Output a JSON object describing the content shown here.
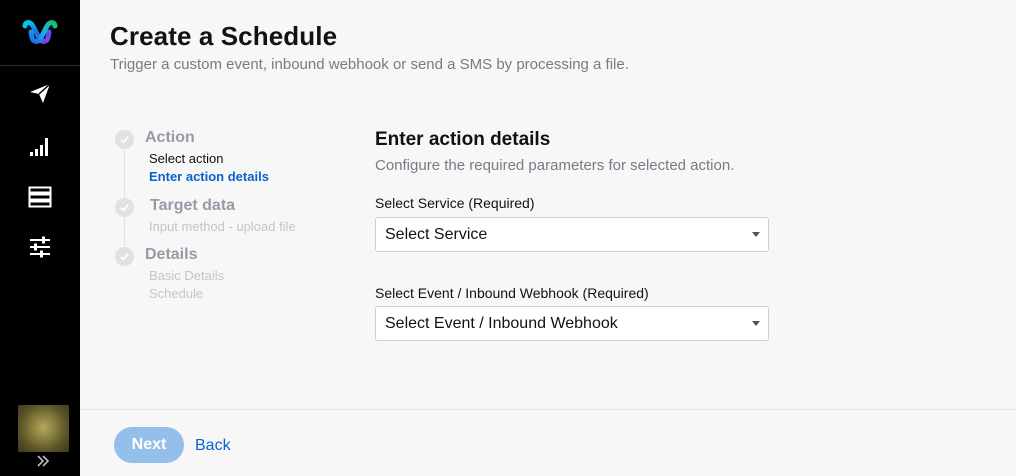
{
  "header": {
    "title": "Create a Schedule",
    "subtitle": "Trigger a custom event, inbound webhook or send a SMS by processing a file."
  },
  "sidebar": {
    "items": [
      {
        "icon": "send-icon"
      },
      {
        "icon": "bar-chart-icon"
      },
      {
        "icon": "table-icon"
      },
      {
        "icon": "sliders-icon"
      }
    ]
  },
  "stepper": {
    "steps": [
      {
        "title": "Action",
        "state": "in-progress",
        "substeps": [
          {
            "label": "Select action",
            "state": "done"
          },
          {
            "label": "Enter action details",
            "state": "active"
          }
        ]
      },
      {
        "title": "Target data",
        "state": "pending",
        "substeps": [
          {
            "label": "Input method - upload file",
            "state": "pending"
          }
        ]
      },
      {
        "title": "Details",
        "state": "pending",
        "substeps": [
          {
            "label": "Basic Details",
            "state": "pending"
          },
          {
            "label": "Schedule",
            "state": "pending"
          }
        ]
      }
    ]
  },
  "form": {
    "title": "Enter action details",
    "description": "Configure the required parameters for selected action.",
    "service": {
      "label": "Select Service (Required)",
      "value": "Select Service"
    },
    "event": {
      "label": "Select Event / Inbound Webhook (Required)",
      "value": "Select Event / Inbound Webhook"
    }
  },
  "footer": {
    "next_label": "Next",
    "back_label": "Back"
  },
  "colors": {
    "accent": "#0a62c9",
    "next_disabled": "#94bfea",
    "sidebar_bg": "#000000"
  }
}
